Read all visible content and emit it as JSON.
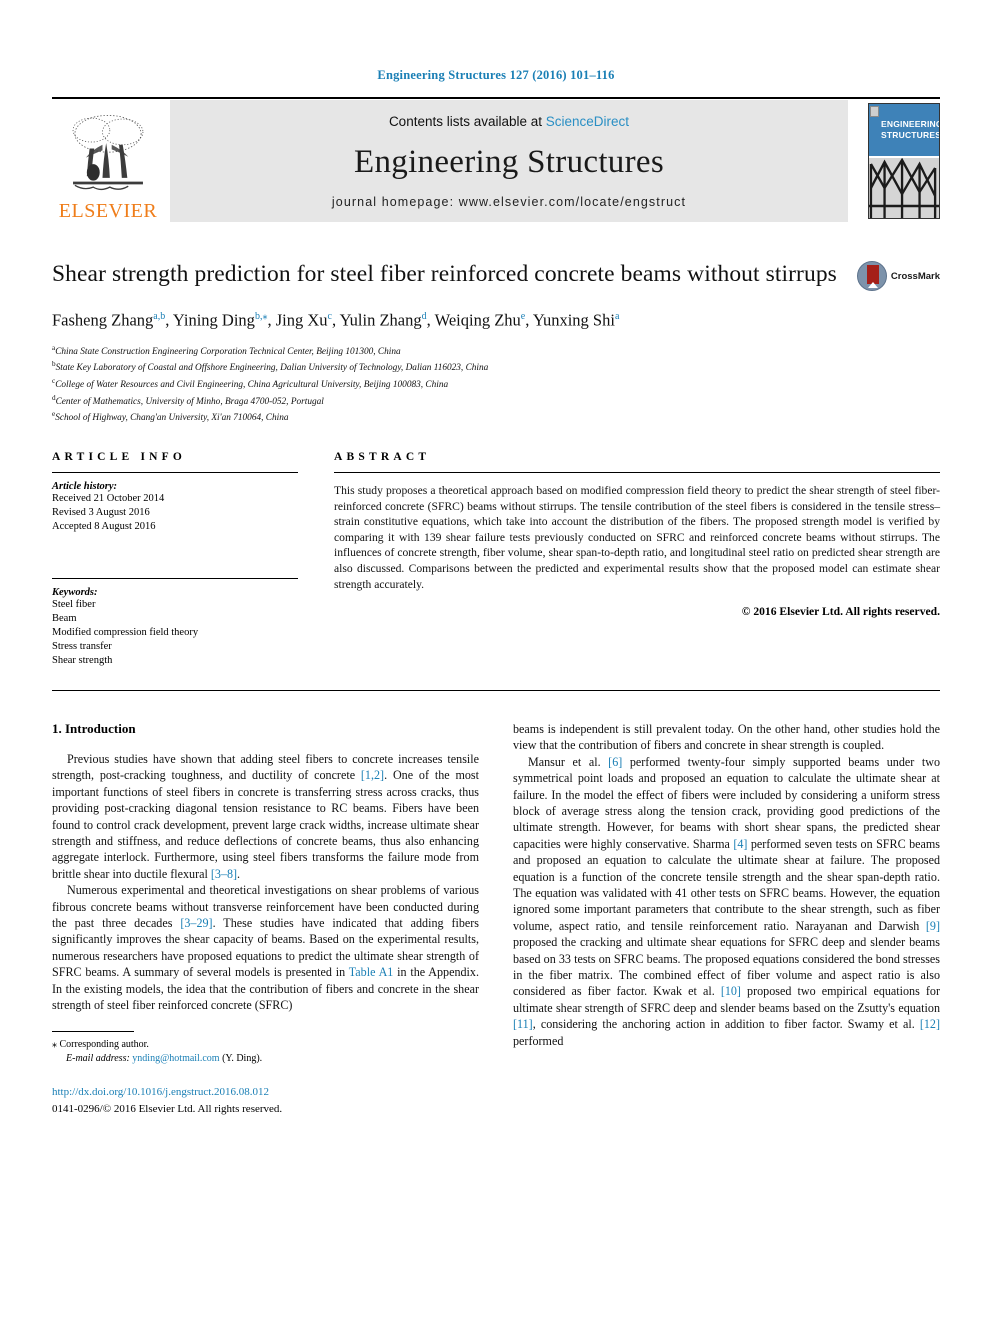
{
  "running_head": "Engineering Structures 127 (2016) 101–116",
  "masthead": {
    "publisher_name": "ELSEVIER",
    "publisher_logo_icon": "elsevier-tree-icon",
    "contents_prefix": "Contents lists available at ",
    "contents_link": "ScienceDirect",
    "journal_name": "Engineering Structures",
    "homepage_text": "journal homepage: www.elsevier.com/locate/engstruct",
    "cover_line1": "ENGINEERING",
    "cover_line2": "STRUCTURES"
  },
  "title": "Shear strength prediction for steel fiber reinforced concrete beams without stirrups",
  "crossmark": {
    "label": "CrossMark",
    "icon": "crossmark-badge-icon"
  },
  "authors": [
    {
      "name": "Fasheng Zhang",
      "sup": "a,b",
      "sep": ", "
    },
    {
      "name": "Yining Ding",
      "sup": "b,",
      "star": "⁎",
      "sep": ", "
    },
    {
      "name": "Jing Xu",
      "sup": "c",
      "sep": ", "
    },
    {
      "name": "Yulin Zhang",
      "sup": "d",
      "sep": ", "
    },
    {
      "name": "Weiqing Zhu",
      "sup": "e",
      "sep": ", "
    },
    {
      "name": "Yunxing Shi",
      "sup": "a",
      "sep": ""
    }
  ],
  "affiliations": [
    {
      "mark": "a",
      "text": "China State Construction Engineering Corporation Technical Center, Beijing 101300, China"
    },
    {
      "mark": "b",
      "text": "State Key Laboratory of Coastal and Offshore Engineering, Dalian University of Technology, Dalian 116023, China"
    },
    {
      "mark": "c",
      "text": "College of Water Resources and Civil Engineering, China Agricultural University, Beijing 100083, China"
    },
    {
      "mark": "d",
      "text": "Center of Mathematics, University of Minho, Braga 4700-052, Portugal"
    },
    {
      "mark": "e",
      "text": "School of Highway, Chang'an University, Xi'an 710064, China"
    }
  ],
  "article_info": {
    "heading": "ARTICLE INFO",
    "history_title": "Article history:",
    "history": [
      "Received 21 October 2014",
      "Revised 3 August 2016",
      "Accepted 8 August 2016"
    ],
    "keywords_title": "Keywords:",
    "keywords": [
      "Steel fiber",
      "Beam",
      "Modified compression field theory",
      "Stress transfer",
      "Shear strength"
    ]
  },
  "abstract": {
    "heading": "ABSTRACT",
    "text": "This study proposes a theoretical approach based on modified compression field theory to predict the shear strength of steel fiber-reinforced concrete (SFRC) beams without stirrups. The tensile contribution of the steel fibers is considered in the tensile stress–strain constitutive equations, which take into account the distribution of the fibers. The proposed strength model is verified by comparing it with 139 shear failure tests previously conducted on SFRC and reinforced concrete beams without stirrups. The influences of concrete strength, fiber volume, shear span-to-depth ratio, and longitudinal steel ratio on predicted shear strength are also discussed. Comparisons between the predicted and experimental results show that the proposed model can estimate shear strength accurately.",
    "copyright": "© 2016 Elsevier Ltd. All rights reserved."
  },
  "section": {
    "number_title": "1. Introduction"
  },
  "left_column_paragraphs": [
    "Previous studies have shown that adding steel fibers to concrete increases tensile strength, post-cracking toughness, and ductility of concrete [1,2]. One of the most important functions of steel fibers in concrete is transferring stress across cracks, thus providing post-cracking diagonal tension resistance to RC beams. Fibers have been found to control crack development, prevent large crack widths, increase ultimate shear strength and stiffness, and reduce deflections of concrete beams, thus also enhancing aggregate interlock. Furthermore, using steel fibers transforms the failure mode from brittle shear into ductile flexural [3–8].",
    "Numerous experimental and theoretical investigations on shear problems of various fibrous concrete beams without transverse reinforcement have been conducted during the past three decades [3–29]. These studies have indicated that adding fibers significantly improves the shear capacity of beams. Based on the experimental results, numerous researchers have proposed equations to predict the ultimate shear strength of SFRC beams. A summary of several models is presented in Table A1 in the Appendix. In the existing models, the idea that the contribution of fibers and concrete in the shear strength of steel fiber reinforced concrete (SFRC)"
  ],
  "right_column_paragraphs": [
    "beams is independent is still prevalent today. On the other hand, other studies hold the view that the contribution of fibers and concrete in shear strength is coupled.",
    "Mansur et al. [6] performed twenty-four simply supported beams under two symmetrical point loads and proposed an equation to calculate the ultimate shear at failure. In the model the effect of fibers were included by considering a uniform stress block of average stress along the tension crack, providing good predictions of the ultimate strength. However, for beams with short shear spans, the predicted shear capacities were highly conservative. Sharma [4] performed seven tests on SFRC beams and proposed an equation to calculate the ultimate shear at failure. The proposed equation is a function of the concrete tensile strength and the shear span-depth ratio. The equation was validated with 41 other tests on SFRC beams. However, the equation ignored some important parameters that contribute to the shear strength, such as fiber volume, aspect ratio, and tensile reinforcement ratio. Narayanan and Darwish [9] proposed the cracking and ultimate shear equations for SFRC deep and slender beams based on 33 tests on SFRC beams. The proposed equations considered the bond stresses in the fiber matrix. The combined effect of fiber volume and aspect ratio is also considered as fiber factor. Kwak et al. [10] proposed two empirical equations for ultimate shear strength of SFRC deep and slender beams based on the Zsutty's equation [11], considering the anchoring action in addition to fiber factor. Swamy et al. [12] performed"
  ],
  "footnotes": {
    "corresponding_mark": "⁎",
    "corresponding_text": "Corresponding author.",
    "email_label": "E-mail address:",
    "email": "ynding@hotmail.com",
    "email_owner": "(Y. Ding).",
    "doi": "http://dx.doi.org/10.1016/j.engstruct.2016.08.012",
    "issn_line": "0141-0296/© 2016 Elsevier Ltd. All rights reserved."
  },
  "colors": {
    "link_blue": "#1a7fb5",
    "elsevier_orange": "#ef7d1a",
    "cover_blue": "#3e82b8",
    "masthead_grey": "#e6e6e6"
  }
}
